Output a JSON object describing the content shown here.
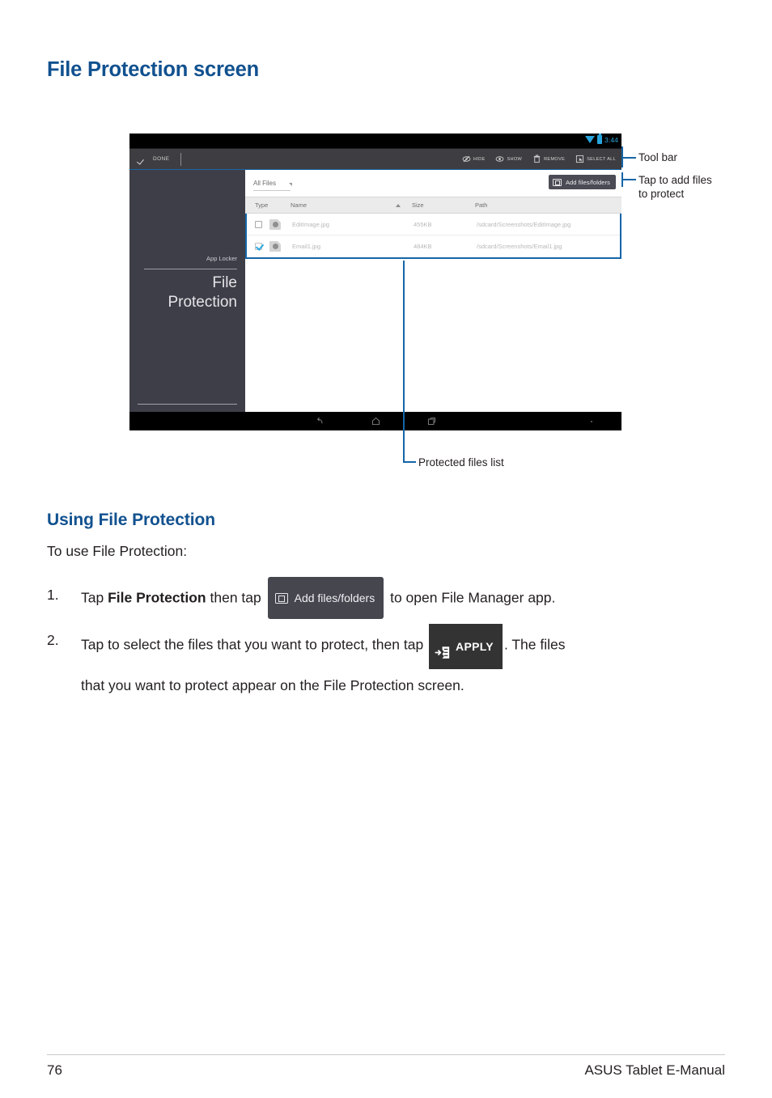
{
  "document": {
    "heading": "File Protection screen",
    "section_heading": "Using File Protection",
    "intro": "To use File Protection:"
  },
  "screenshot": {
    "status_bar": {
      "time": "3:44",
      "wifi_icon": "wifi-icon",
      "battery_icon": "battery-icon"
    },
    "toolbar": {
      "check_icon": "check-icon",
      "done_label": "DONE",
      "actions": [
        {
          "label": "HIDE",
          "icon": "hide-eye-icon"
        },
        {
          "label": "SHOW",
          "icon": "show-eye-icon"
        },
        {
          "label": "REMOVE",
          "icon": "trash-icon"
        },
        {
          "label": "SELECT ALL",
          "icon": "select-all-icon"
        }
      ]
    },
    "sidebar": {
      "app_label": "App Locker",
      "title_line1": "File",
      "title_line2": "Protection"
    },
    "content": {
      "filter_label": "All Files",
      "filter_caret_icon": "caret-down-icon",
      "add_button": {
        "label": "Add files/folders",
        "icon": "add-files-icon"
      },
      "columns": [
        "Type",
        "Name",
        "Size",
        "Path"
      ],
      "sort_icon": "sort-ascending-icon",
      "rows": [
        {
          "checked": false,
          "icon": "image-file-icon",
          "name": "EditImage.jpg",
          "size": "455KB",
          "path": "/sdcard/Screenshots/EditImage.jpg"
        },
        {
          "checked": true,
          "icon": "image-file-icon",
          "name": "Email1.jpg",
          "size": "484KB",
          "path": "/sdcard/Screenshots/Email1.jpg"
        }
      ]
    },
    "navbar": {
      "back_icon": "back-icon",
      "home_icon": "home-icon",
      "recents_icon": "recent-apps-icon"
    }
  },
  "callouts": {
    "toolbar": "Tool bar",
    "add_files": "Tap to add files\nto protect",
    "protected_list": "Protected files list"
  },
  "steps": [
    {
      "number": "1.",
      "text_before": "Tap ",
      "bold": "File Protection",
      "text_mid": " then tap ",
      "button_label": "Add files/folders",
      "button_icon": "add-files-icon",
      "text_after": " to open File Manager app."
    },
    {
      "number": "2.",
      "text_before": "Tap to select the files that you want to protect, then tap ",
      "button_label": "APPLY",
      "button_icon": "apply-icon",
      "text_after": ". The files",
      "line2": "that you want to protect appear on the File Protection screen."
    }
  ],
  "footer": {
    "page_number": "76",
    "manual_title": "ASUS Tablet E-Manual"
  },
  "colors": {
    "heading_blue": "#11518f",
    "accent_blue": "#1565a8",
    "checkbox_blue": "#2aa9e0"
  }
}
